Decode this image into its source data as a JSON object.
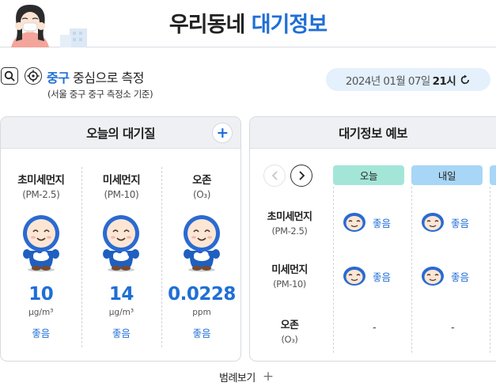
{
  "header": {
    "title_part1": "우리동네",
    "title_part2": "대기정보"
  },
  "location": {
    "district": "중구",
    "rest": "중심으로 측정",
    "note": "(서울 중구 중구 측정소 기준)",
    "datetime": "2024년 01월 07일",
    "hour": "21시"
  },
  "today": {
    "title": "오늘의 대기질",
    "pollutants": [
      {
        "name": "초미세먼지",
        "code": "(PM-2.5)",
        "value": "10",
        "unit": "μg/m³",
        "grade": "좋음"
      },
      {
        "name": "미세먼지",
        "code": "(PM-10)",
        "value": "14",
        "unit": "μg/m³",
        "grade": "좋음"
      },
      {
        "name": "오존",
        "code": "(O₃)",
        "value": "0.0228",
        "unit": "ppm",
        "grade": "좋음"
      }
    ]
  },
  "forecast": {
    "title": "대기정보 예보",
    "tabs": [
      "오늘",
      "내일"
    ],
    "rows": [
      {
        "name": "초미세먼지",
        "code": "(PM-2.5)",
        "today": "좋음",
        "tomorrow": "좋음"
      },
      {
        "name": "미세먼지",
        "code": "(PM-10)",
        "today": "좋음",
        "tomorrow": "좋음"
      },
      {
        "name": "오존",
        "code": "(O₃)",
        "today": "-",
        "tomorrow": "-"
      }
    ]
  },
  "legend_label": "범례보기",
  "colors": {
    "accent": "#1f6fd6",
    "today_tab": "#a3e6d8",
    "tomorrow_tab": "#a7d6f6",
    "panel_header": "#eef0f3",
    "date_pill": "#e4f0fb"
  }
}
